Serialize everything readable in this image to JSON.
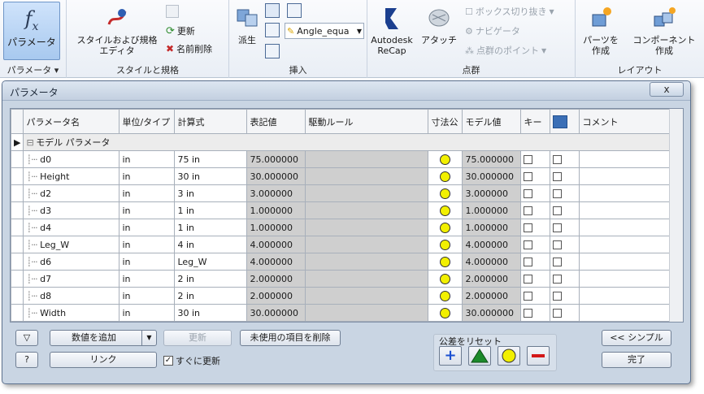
{
  "ribbon": {
    "parameters_panel": {
      "button_label": "パラメータ",
      "title": "パラメータ ▾"
    },
    "styles_panel": {
      "style_editor_label_1": "スタイルおよび規格",
      "style_editor_label_2": "エディタ",
      "update_label": "更新",
      "purge_label": "名前削除",
      "title": "スタイルと規格"
    },
    "insert_panel": {
      "derive_label": "派生",
      "dropdown_value": "Angle_equa",
      "title": "挿入"
    },
    "point_cloud_panel": {
      "recap_label_1": "Autodesk",
      "recap_label_2": "ReCap",
      "attach_label": "アタッチ",
      "box_cut_label": "ボックス切り抜き",
      "navigator_label": "ナビゲータ",
      "points_label": "点群のポイント",
      "title": "点群"
    },
    "layout_panel": {
      "make_part_label_1": "パーツを",
      "make_part_label_2": "作成",
      "make_component_label_1": "コンポーネント",
      "make_component_label_2": "作成",
      "title": "レイアウト"
    }
  },
  "dialog": {
    "title": "パラメータ",
    "close": "x",
    "columns": [
      "パラメータ名",
      "単位/タイプ",
      "計算式",
      "表記値",
      "駆動ルール",
      "寸法公",
      "モデル値",
      "キー",
      "",
      "コメント"
    ],
    "group_label": "モデル パラメータ",
    "rows": [
      {
        "name": "d0",
        "unit": "in",
        "equation": "75 in",
        "nominal": "75.000000",
        "model": "75.000000"
      },
      {
        "name": "Height",
        "unit": "in",
        "equation": "30 in",
        "nominal": "30.000000",
        "model": "30.000000"
      },
      {
        "name": "d2",
        "unit": "in",
        "equation": "3 in",
        "nominal": "3.000000",
        "model": "3.000000"
      },
      {
        "name": "d3",
        "unit": "in",
        "equation": "1 in",
        "nominal": "1.000000",
        "model": "1.000000"
      },
      {
        "name": "d4",
        "unit": "in",
        "equation": "1 in",
        "nominal": "1.000000",
        "model": "1.000000"
      },
      {
        "name": "Leg_W",
        "unit": "in",
        "equation": "4 in",
        "nominal": "4.000000",
        "model": "4.000000"
      },
      {
        "name": "d6",
        "unit": "in",
        "equation": "Leg_W",
        "nominal": "4.000000",
        "model": "4.000000"
      },
      {
        "name": "d7",
        "unit": "in",
        "equation": "2 in",
        "nominal": "2.000000",
        "model": "2.000000"
      },
      {
        "name": "d8",
        "unit": "in",
        "equation": "2 in",
        "nominal": "2.000000",
        "model": "2.000000"
      },
      {
        "name": "Width",
        "unit": "in",
        "equation": "30 in",
        "nominal": "30.000000",
        "model": "30.000000"
      }
    ],
    "buttons": {
      "add_numeric": "数値を追加",
      "update": "更新",
      "purge_unused": "未使用の項目を削除",
      "link": "リンク",
      "immediate_update": "すぐに更新",
      "reset_tolerance": "公差をリセット",
      "less": "<< シンプル",
      "done": "完了"
    }
  },
  "colors": {
    "accent": "#a8c9ef",
    "tolerance_dot": "#f2f000",
    "plus": "#1a4fd1",
    "triangle": "#1c8a2a",
    "minus": "#d31818"
  }
}
